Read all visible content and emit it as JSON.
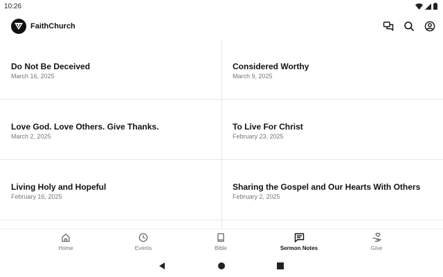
{
  "status": {
    "time": "10:26"
  },
  "app": {
    "title": "FaithChurch"
  },
  "sermons": [
    {
      "title": "Do Not Be Deceived",
      "date": "March 16, 2025"
    },
    {
      "title": "Considered Worthy",
      "date": "March 9, 2025"
    },
    {
      "title": "Love God. Love Others. Give Thanks.",
      "date": "March 2, 2025"
    },
    {
      "title": "To Live For Christ",
      "date": "February 23, 2025"
    },
    {
      "title": "Living Holy and Hopeful",
      "date": "February 16, 2025"
    },
    {
      "title": "Sharing the Gospel and Our Hearts With Others",
      "date": "February 2, 2025"
    }
  ],
  "bottom_nav": {
    "active": "Sermon Notes",
    "items": [
      {
        "label": "Home",
        "icon": "home-icon"
      },
      {
        "label": "Events",
        "icon": "clock-icon"
      },
      {
        "label": "Bible",
        "icon": "book-icon"
      },
      {
        "label": "Sermon Notes",
        "icon": "notes-icon"
      },
      {
        "label": "Give",
        "icon": "give-icon"
      }
    ]
  },
  "icons": {
    "app_bar": [
      "chat-icon",
      "search-icon",
      "account-icon"
    ],
    "system_nav": [
      "back-icon",
      "home-circle-icon",
      "recents-icon"
    ]
  },
  "colors": {
    "text": "#111111",
    "secondary": "#777777",
    "divider": "#e7e7e7",
    "background": "#ffffff"
  }
}
